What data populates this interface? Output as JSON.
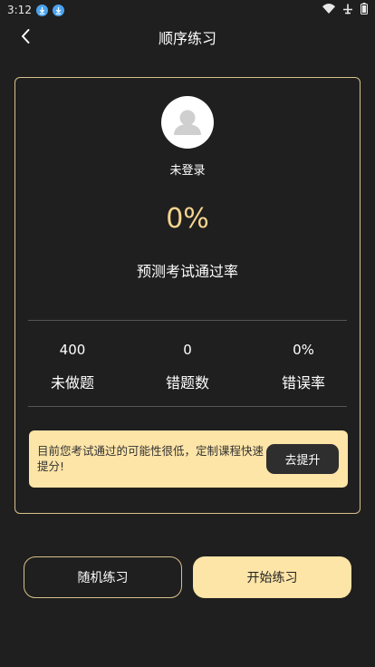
{
  "status_bar": {
    "time": "3:12"
  },
  "nav": {
    "title": "顺序练习"
  },
  "profile": {
    "login_status": "未登录"
  },
  "prediction": {
    "pass_rate": "0%",
    "label": "预测考试通过率"
  },
  "stats": [
    {
      "value": "400",
      "label": "未做题"
    },
    {
      "value": "0",
      "label": "错题数"
    },
    {
      "value": "0%",
      "label": "错误率"
    }
  ],
  "promo": {
    "text": "目前您考试通过的可能性很低，定制课程快速提分!",
    "button": "去提升"
  },
  "actions": {
    "random": "随机练习",
    "start": "开始练习"
  },
  "colors": {
    "accent": "#f6d48e",
    "promo_bg": "#fde4a7",
    "border": "#d9c08a",
    "background": "#1f1f1f"
  }
}
